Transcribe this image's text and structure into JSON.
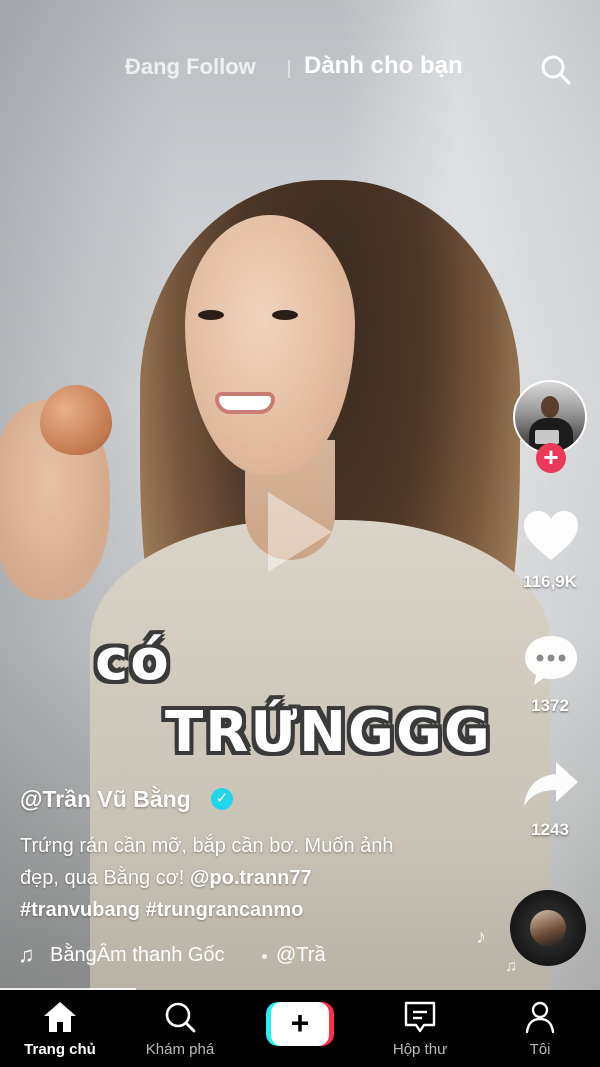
{
  "top_tabs": {
    "following": "Đang Follow",
    "for_you": "Dành cho bạn"
  },
  "video": {
    "sticker_line1": "có",
    "sticker_line2": "TRỨNGGG"
  },
  "rail": {
    "likes": "116,9K",
    "comments": "1372",
    "shares": "1243",
    "follow_symbol": "+"
  },
  "caption": {
    "username": "@Trần Vũ Bằng",
    "verified_symbol": "✓",
    "desc_line1": "Trứng rán cần mỡ, bắp cần bơ. Muốn ảnh",
    "desc_line2_text": "đẹp, qua Bằng cơ! ",
    "desc_mention": "@po.trann77",
    "desc_hashtags": "#tranvubang #trungrancanmo"
  },
  "music": {
    "note": "♫",
    "text": "BằngÂm thanh Gốc",
    "text2": "@Trầ"
  },
  "bottom_nav": {
    "home": "Trang chủ",
    "discover": "Khám phá",
    "create_symbol": "+",
    "inbox": "Hộp thư",
    "profile": "Tôi"
  },
  "colors": {
    "accent_red": "#fe2c55",
    "accent_cyan": "#25f4ee",
    "verified": "#20d5ec",
    "follow_plus": "#ea3a5a"
  },
  "icons": [
    "search-icon",
    "heart-icon",
    "comment-icon",
    "share-icon",
    "home-icon",
    "discover-icon",
    "inbox-icon",
    "profile-icon",
    "music-note-icon",
    "play-icon",
    "verified-icon"
  ]
}
